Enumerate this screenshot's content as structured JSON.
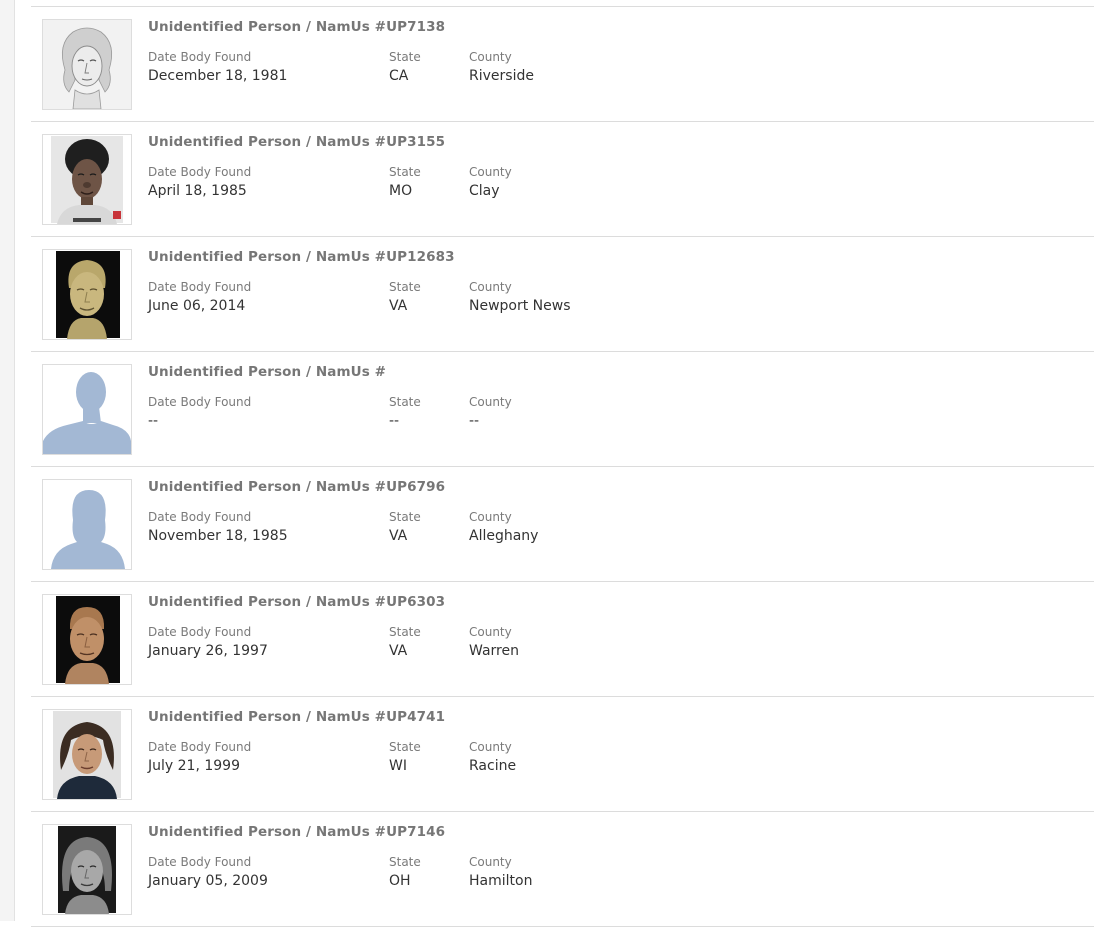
{
  "labels": {
    "date": "Date Body Found",
    "state": "State",
    "county": "County"
  },
  "results": [
    {
      "title": "Unidentified Person / NamUs #UP7138",
      "date": "December 18, 1981",
      "state": "CA",
      "county": "Riverside",
      "image": "pencil-sketch-face"
    },
    {
      "title": "Unidentified Person / NamUs #UP3155",
      "date": "April 18, 1985",
      "state": "MO",
      "county": "Clay",
      "image": "composite-face"
    },
    {
      "title": "Unidentified Person / NamUs #UP12683",
      "date": "June 06, 2014",
      "state": "VA",
      "county": "Newport News",
      "image": "clay-reconstruction-face"
    },
    {
      "title": "Unidentified Person / NamUs #",
      "date": "--",
      "state": "--",
      "county": "--",
      "image": "male-silhouette"
    },
    {
      "title": "Unidentified Person / NamUs #UP6796",
      "date": "November 18, 1985",
      "state": "VA",
      "county": "Alleghany",
      "image": "female-silhouette"
    },
    {
      "title": "Unidentified Person / NamUs #UP6303",
      "date": "January 26, 1997",
      "state": "VA",
      "county": "Warren",
      "image": "clay-reconstruction-face"
    },
    {
      "title": "Unidentified Person / NamUs #UP4741",
      "date": "July 21, 1999",
      "state": "WI",
      "county": "Racine",
      "image": "digital-rendering-face"
    },
    {
      "title": "Unidentified Person / NamUs #UP7146",
      "date": "January 05, 2009",
      "state": "OH",
      "county": "Hamilton",
      "image": "grayscale-rendering-face"
    }
  ],
  "colors": {
    "silhouette": "#a3b8d4",
    "title_text": "#767676",
    "value_text": "#333333",
    "divider": "#dcdcdc"
  }
}
